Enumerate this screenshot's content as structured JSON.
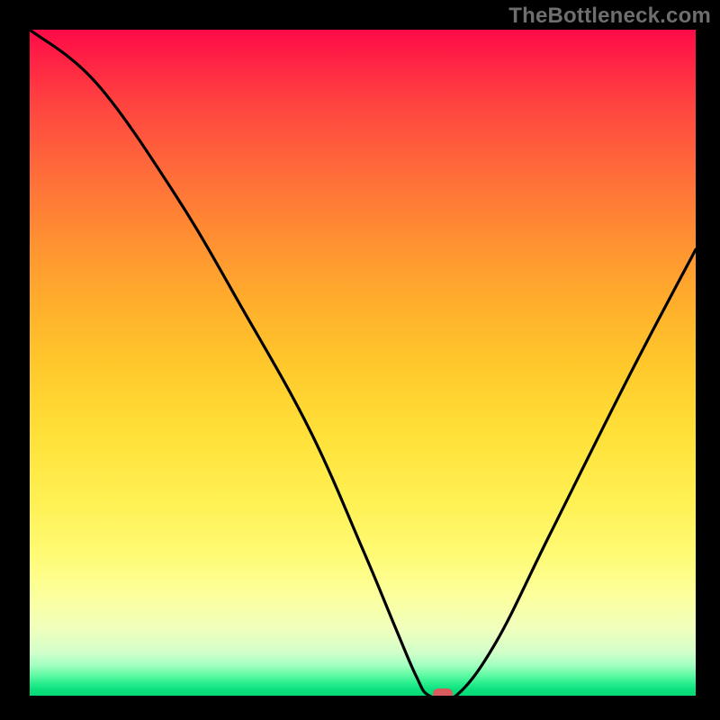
{
  "watermark": "TheBottleneck.com",
  "chart_data": {
    "type": "line",
    "title": "",
    "xlabel": "",
    "ylabel": "",
    "xlim": [
      0,
      100
    ],
    "ylim": [
      0,
      100
    ],
    "series": [
      {
        "name": "curve",
        "x": [
          0,
          10,
          22,
          32,
          42,
          50,
          55,
          58,
          60,
          64,
          70,
          78,
          90,
          100
        ],
        "y": [
          100,
          92,
          75,
          58,
          40,
          22,
          10,
          3,
          0,
          0,
          8,
          24,
          48,
          67
        ]
      }
    ],
    "marker": {
      "x": 62,
      "y": 0
    },
    "colors": {
      "curve_stroke": "#000000",
      "marker_fill": "#d85b5d",
      "gradient_top": "#ff0a48",
      "gradient_bottom": "#04d975",
      "frame_bg": "#000000"
    }
  }
}
